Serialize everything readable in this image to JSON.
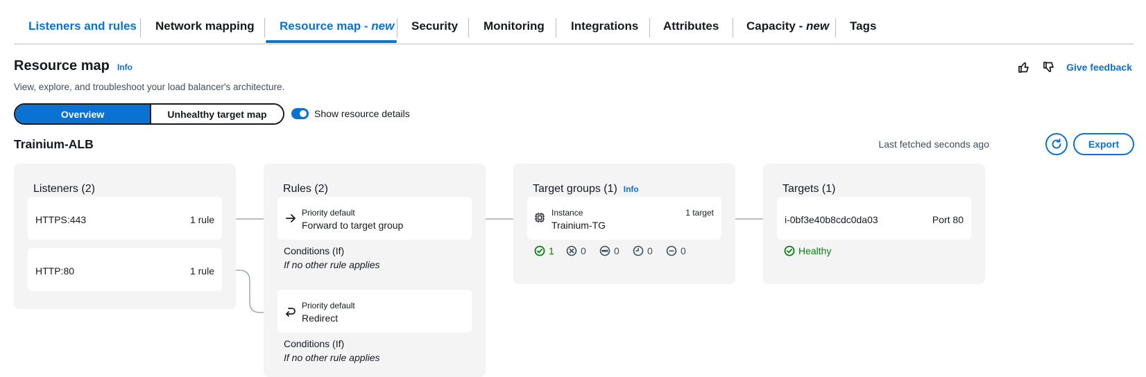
{
  "tabs": [
    {
      "label": "Listeners and rules",
      "style": "link"
    },
    {
      "label": "Network mapping"
    },
    {
      "label": "Resource map - ",
      "italic": "new",
      "active": true
    },
    {
      "label": "Security"
    },
    {
      "label": "Monitoring"
    },
    {
      "label": "Integrations"
    },
    {
      "label": "Attributes"
    },
    {
      "label": "Capacity - ",
      "italic": "new"
    },
    {
      "label": "Tags"
    }
  ],
  "header": {
    "title": "Resource map",
    "info": "Info",
    "description": "View, explore, and troubleshoot your load balancer's architecture.",
    "feedback": "Give feedback"
  },
  "view_toggle": {
    "overview": "Overview",
    "unhealthy": "Unhealthy target map",
    "show_details": "Show resource details",
    "show_details_on": true
  },
  "load_balancer": {
    "name": "Trainium-ALB",
    "fetched": "Last fetched seconds ago",
    "export": "Export"
  },
  "listeners": {
    "title": "Listeners (2)",
    "items": [
      {
        "name": "HTTPS:443",
        "rules": "1 rule"
      },
      {
        "name": "HTTP:80",
        "rules": "1 rule"
      }
    ]
  },
  "rules": {
    "title": "Rules (2)",
    "items": [
      {
        "priority": "Priority default",
        "action": "Forward to target group",
        "cond_label": "Conditions (If)",
        "cond_value": "If no other rule applies",
        "icon": "arrow-right-icon"
      },
      {
        "priority": "Priority default",
        "action": "Redirect",
        "cond_label": "Conditions (If)",
        "cond_value": "If no other rule applies",
        "icon": "redirect-icon"
      }
    ]
  },
  "target_groups": {
    "title": "Target groups (1)",
    "info": "Info",
    "items": [
      {
        "type": "Instance",
        "name": "Trainium-TG",
        "count": "1 target"
      }
    ],
    "stats": {
      "healthy": "1",
      "unhealthy": "0",
      "unused": "0",
      "initial": "0",
      "draining": "0"
    }
  },
  "targets": {
    "title": "Targets (1)",
    "items": [
      {
        "id": "i-0bf3e40b8cdc0da03",
        "port": "Port 80",
        "health": "Healthy"
      }
    ]
  },
  "colors": {
    "accent": "#0972d3",
    "success": "#037f0c",
    "panel": "#f4f4f5"
  }
}
